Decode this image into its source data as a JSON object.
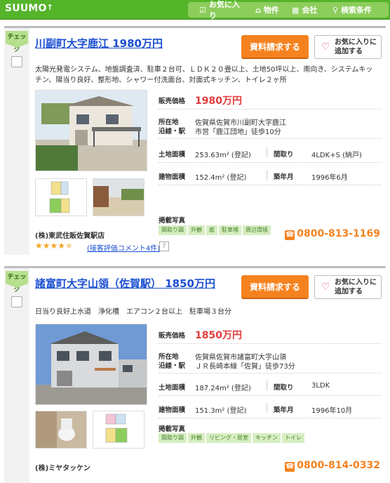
{
  "header": {
    "logo": "SUUMO",
    "nav": [
      {
        "label": "お気に入り",
        "icon": "checkbox-icon"
      },
      {
        "label": "物件",
        "icon": "house-icon"
      },
      {
        "label": "会社",
        "icon": "building-icon"
      },
      {
        "label": "検索条件",
        "icon": "search-icon"
      }
    ]
  },
  "common": {
    "check_label": "チェック",
    "request_button": "資料請求する",
    "fav_button_line1": "お気に入りに",
    "fav_button_line2": "追加する",
    "label_price": "販売価格",
    "label_location": "所在地",
    "label_line": "沿線・駅",
    "label_land": "土地面積",
    "label_layout": "間取り",
    "label_building": "建物面積",
    "label_year": "築年月",
    "label_photos": "掲載写真"
  },
  "listings": [
    {
      "title": "川副町大字鹿江 1980万円",
      "description": "太陽光発電システム、地盤調査済、駐車２台可、ＬＤＫ２０畳以上、土地50坪以上、南向き、システムキッチン、陽当り良好、整形地、シャワー付洗面台、対面式キッチン、トイレ２ヶ所",
      "price": "1980万円",
      "location": "佐賀県佐賀市川副町大字鹿江",
      "station": "市営「鹿江団地」徒歩10分",
      "land_area": "253.63m² (登記)",
      "layout": "4LDK+S (納戸)",
      "building_area": "152.4m² (登記)",
      "built": "1996年6月",
      "photo_tags": [
        "間取り図",
        "外観",
        "庭",
        "駐車場",
        "周辺環境"
      ],
      "company": "(株)東武住販佐賀駅店",
      "phone": "0800-813-1169",
      "rating": 4.5,
      "review_link": "(接客評価コメント4件)"
    },
    {
      "title": "諸富町大字山領（佐賀駅） 1850万円",
      "description": "日当り良好上水道　浄化槽　エアコン２台以上　駐車場３台分",
      "price": "1850万円",
      "location": "佐賀県佐賀市諸富町大字山領",
      "station": "ＪＲ長崎本線「佐賀」徒歩73分",
      "land_area": "187.24m² (登記)",
      "layout": "3LDK",
      "building_area": "151.3m² (登記)",
      "built": "1996年10月",
      "photo_tags": [
        "間取り図",
        "外観",
        "リビング・居室",
        "キッチン",
        "トイレ"
      ],
      "company": "(株)ミヤタッケン",
      "phone": "0800-814-0332"
    }
  ]
}
